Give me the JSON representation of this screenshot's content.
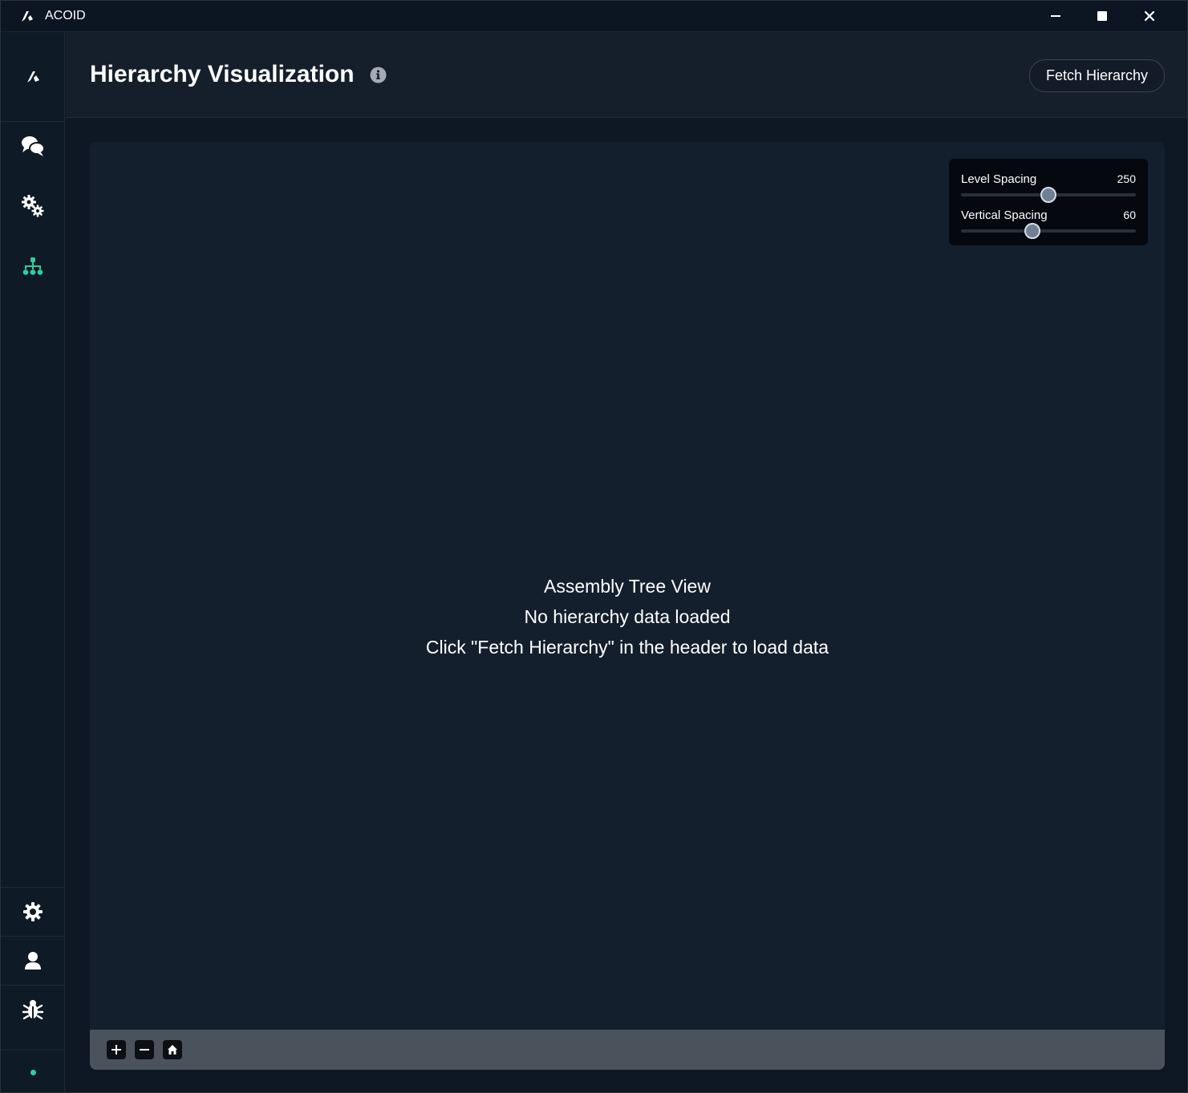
{
  "window": {
    "title": "ACOID",
    "controls": [
      "minimize-icon",
      "maximize-icon",
      "close-icon"
    ]
  },
  "sidebar": {
    "items": [
      {
        "name": "logo",
        "icon": "app-logo-icon"
      },
      {
        "name": "chat",
        "icon": "chat-bubbles-icon"
      },
      {
        "name": "automation",
        "icon": "gears-icon"
      },
      {
        "name": "hierarchy",
        "icon": "sitemap-icon",
        "active": true
      },
      {
        "name": "settings",
        "icon": "gear-icon"
      },
      {
        "name": "profile",
        "icon": "user-icon"
      },
      {
        "name": "debug",
        "icon": "bug-icon"
      }
    ],
    "status": "online-indicator"
  },
  "header": {
    "title": "Hierarchy Visualization",
    "info_icon": "info-icon",
    "fetch_label": "Fetch Hierarchy"
  },
  "canvas": {
    "empty_title": "Assembly Tree View",
    "empty_line1": "No hierarchy data loaded",
    "empty_line2": "Click \"Fetch Hierarchy\" in the header to load data",
    "spacing": {
      "level_label": "Level Spacing",
      "level_value": "250",
      "level_fraction": 0.5,
      "vertical_label": "Vertical Spacing",
      "vertical_value": "60",
      "vertical_fraction": 0.41
    },
    "toolbar": [
      "zoom-in-icon",
      "zoom-out-icon",
      "home-icon"
    ]
  },
  "colors": {
    "accent": "#2ecf9e",
    "background": "#0e1824",
    "panel": "#131f2d",
    "toolbar": "#4a525c"
  }
}
